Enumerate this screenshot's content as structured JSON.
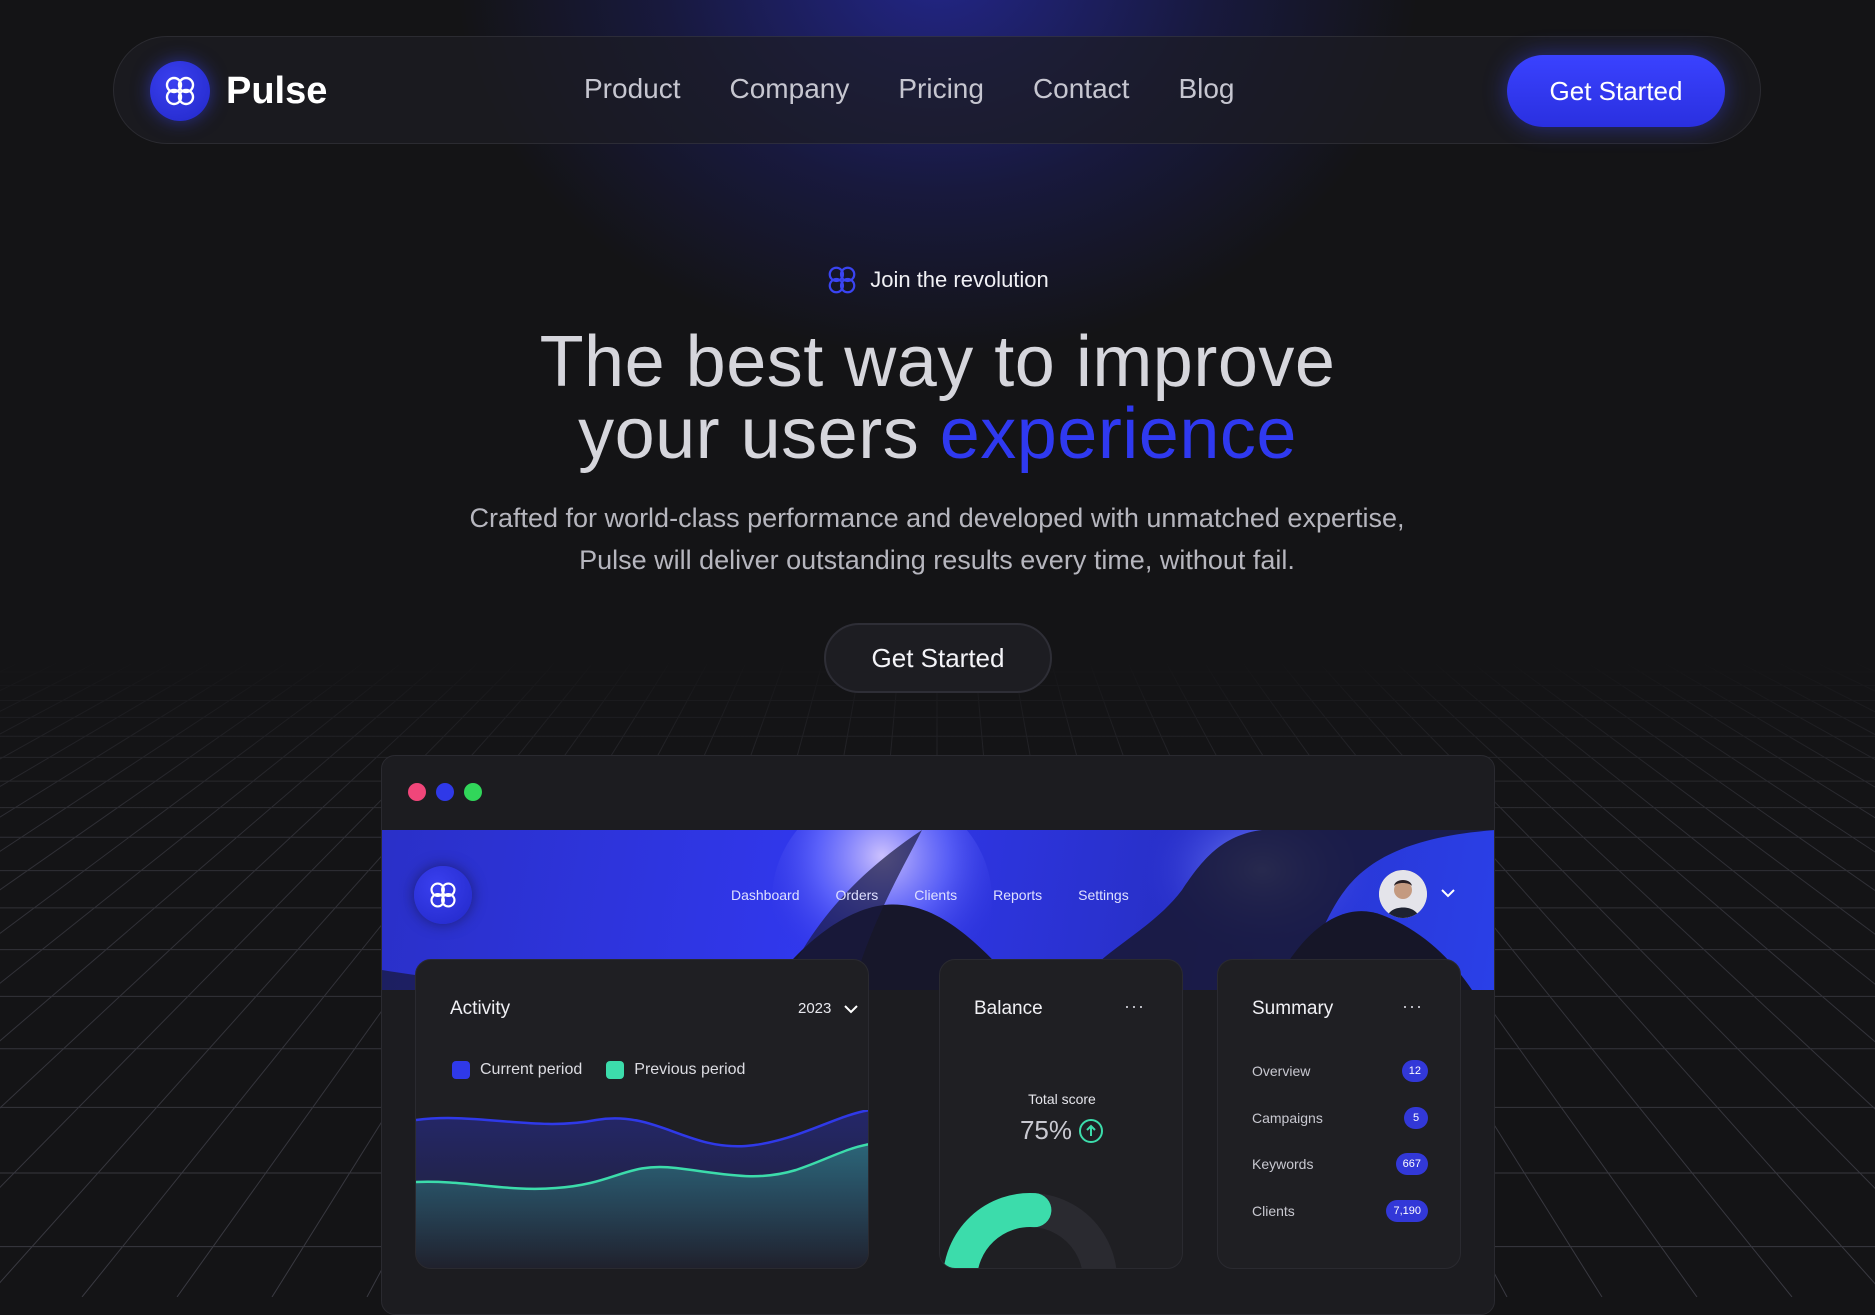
{
  "nav": {
    "brand": "Pulse",
    "links": [
      "Product",
      "Company",
      "Pricing",
      "Contact",
      "Blog"
    ],
    "cta_label": "Get Started"
  },
  "hero": {
    "eyebrow": "Join the revolution",
    "headline_line1": "The best way to improve",
    "headline_line2_plain": "your users ",
    "headline_line2_accent": "experience",
    "subtitle": "Crafted for world-class performance and developed with unmatched expertise, Pulse will deliver outstanding results every time, without fail.",
    "cta_label": "Get Started"
  },
  "app": {
    "window_dots": [
      "#f0467a",
      "#2f39e8",
      "#31d65a"
    ],
    "tabs": [
      "Dashboard",
      "Orders",
      "Clients",
      "Reports",
      "Settings"
    ],
    "activity": {
      "title": "Activity",
      "year": "2023",
      "legend": [
        {
          "label": "Current period",
          "color": "#2f39e8"
        },
        {
          "label": "Previous period",
          "color": "#3cdcab"
        }
      ]
    },
    "balance": {
      "title": "Balance",
      "more": "···",
      "score_label": "Total score",
      "score_value": "75%",
      "score_fraction": 0.75
    },
    "summary": {
      "title": "Summary",
      "more": "···",
      "rows": [
        {
          "label": "Overview",
          "count": "12"
        },
        {
          "label": "Campaigns",
          "count": "5"
        },
        {
          "label": "Keywords",
          "count": "667"
        },
        {
          "label": "Clients",
          "count": "7,190"
        }
      ]
    }
  },
  "colors": {
    "accent": "#2f39f0",
    "background": "#141416",
    "teal": "#3cdcab"
  }
}
